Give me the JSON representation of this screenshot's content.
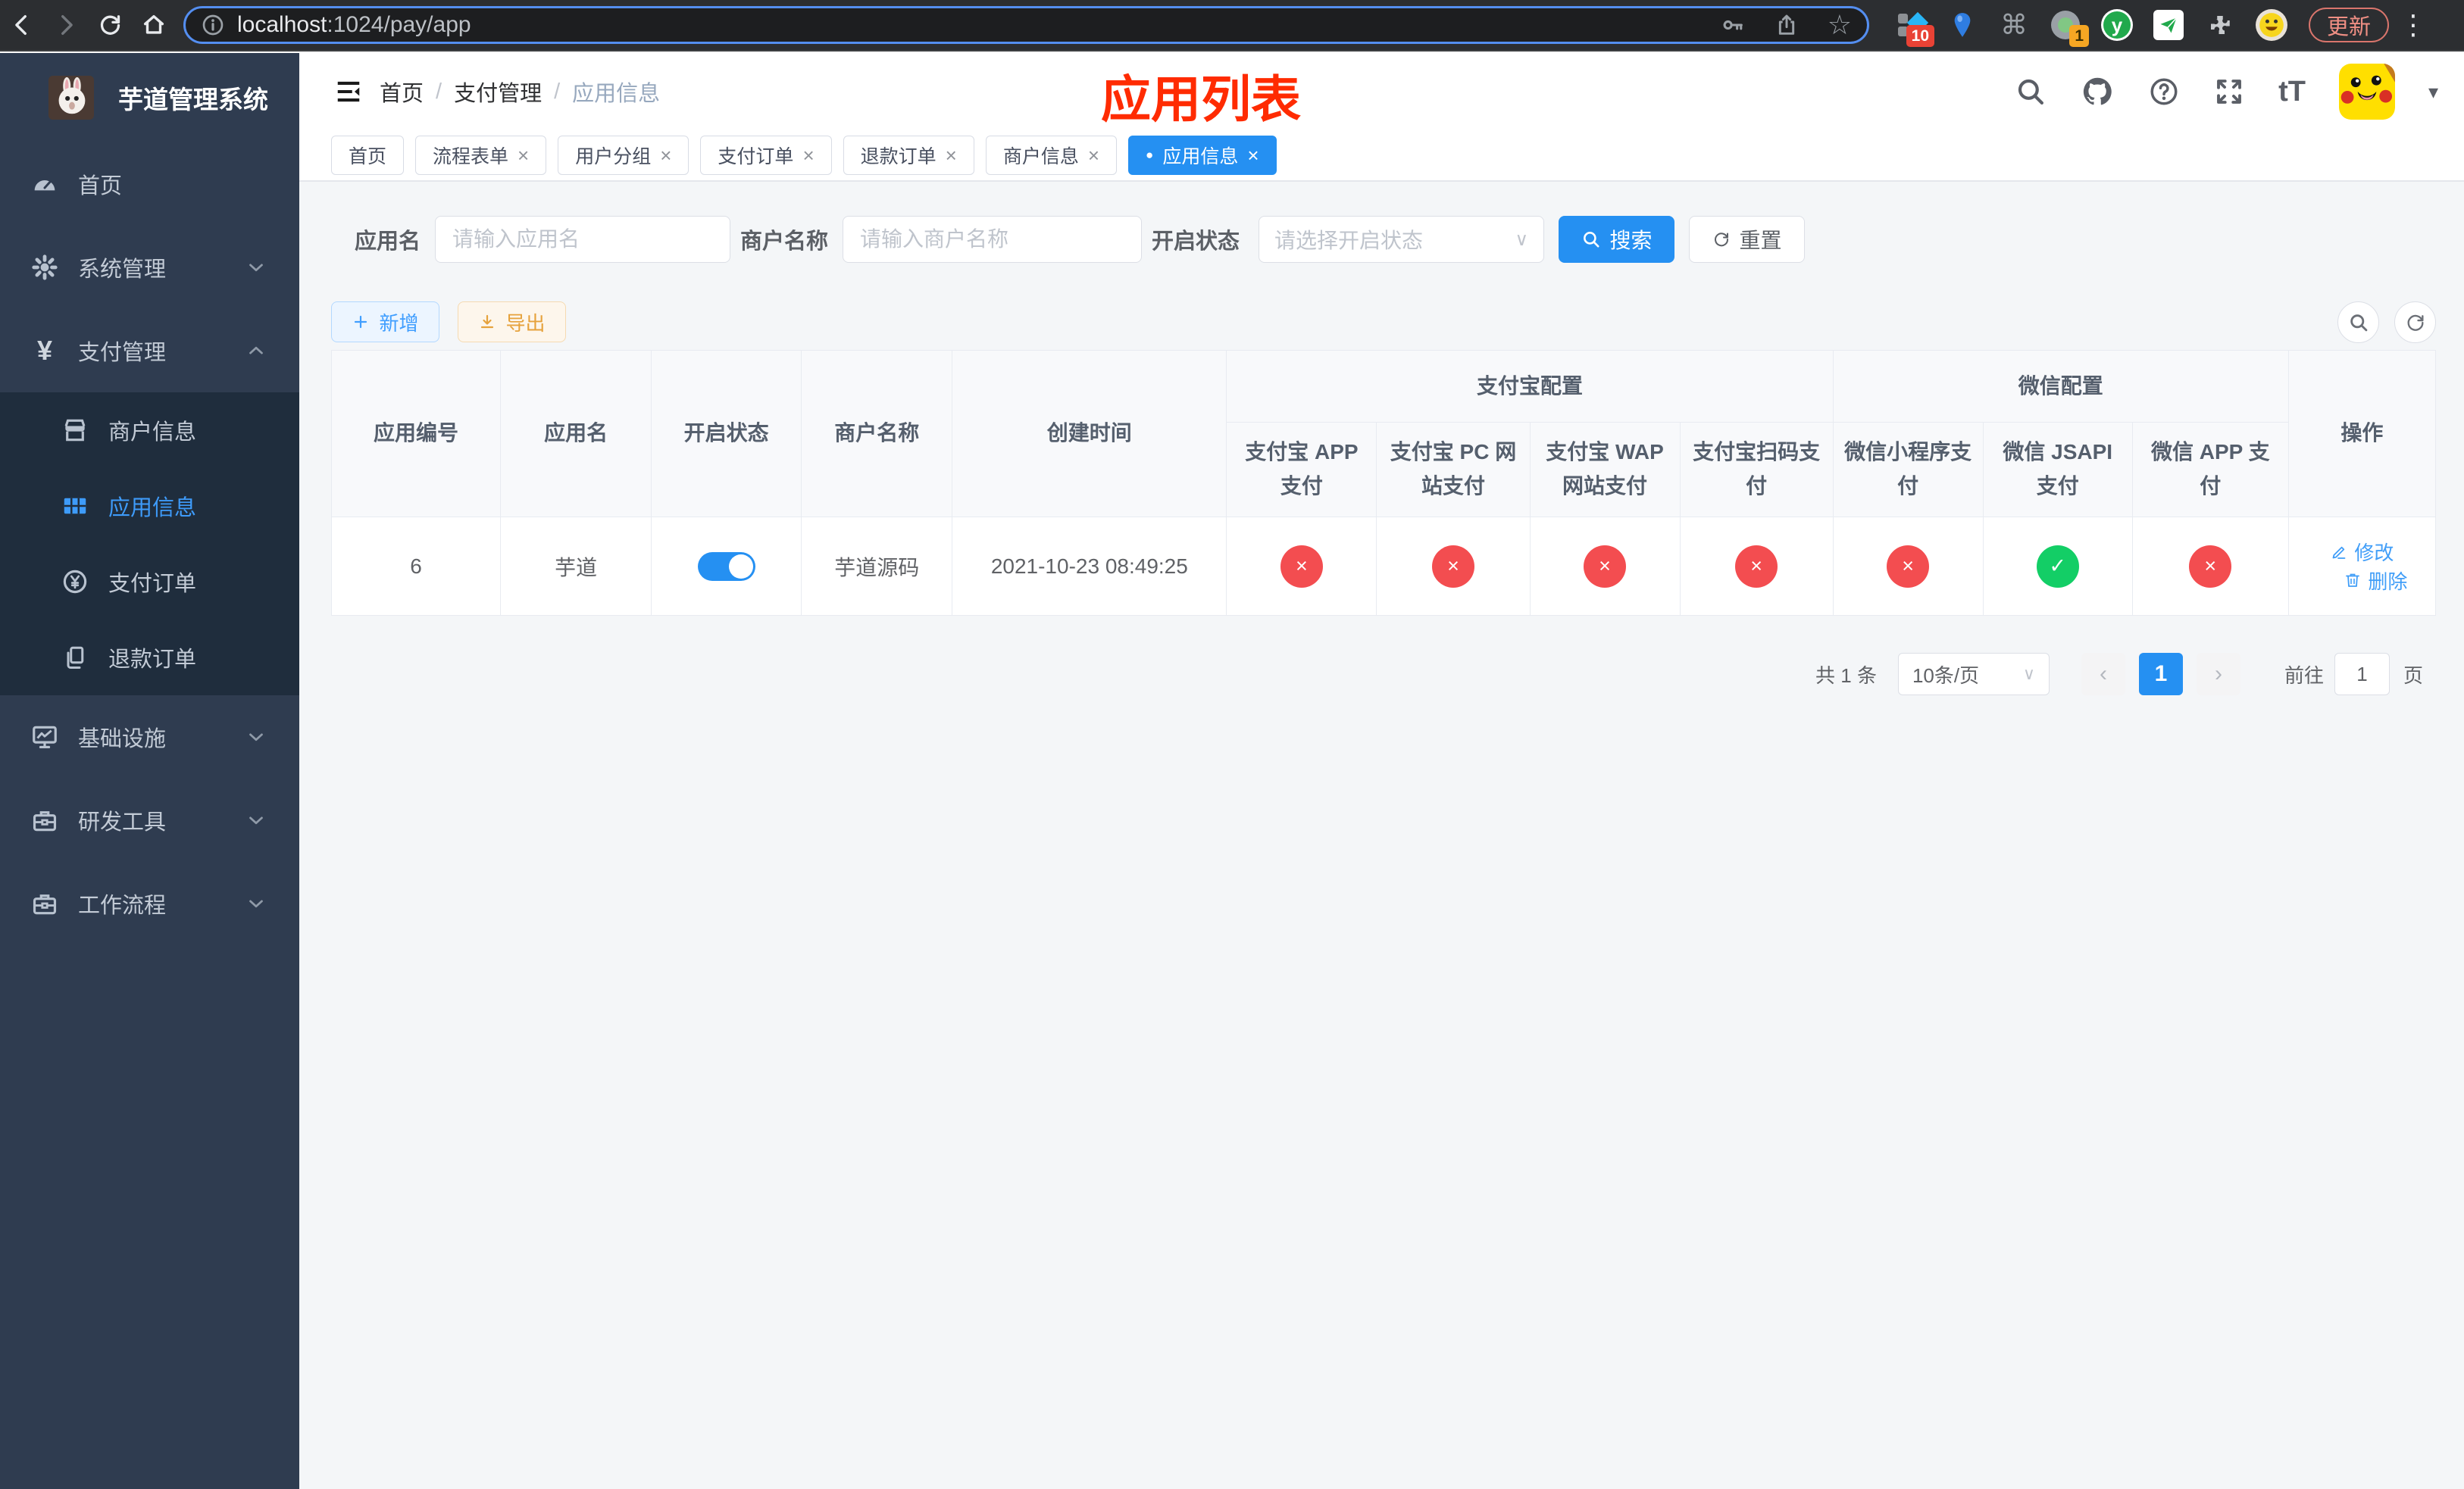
{
  "browser": {
    "url": {
      "host": "localhost",
      "path": ":1024/pay/app"
    },
    "update_button": "更新",
    "extension_badges": {
      "first": "10",
      "second": "1"
    }
  },
  "icons": {
    "close": "×",
    "check": "✓",
    "cross": "×",
    "prev": "‹",
    "next": "›",
    "dot": "●",
    "star": "☆",
    "command": "⌘",
    "dots_vertical": "⋮",
    "caret_down": "▾",
    "yen": "¥",
    "question": "?",
    "font_size": "tT",
    "y_letter": "y",
    "select_caret": "∨"
  },
  "sidebar": {
    "title": "芋道管理系统",
    "menu": [
      {
        "label": "首页"
      },
      {
        "label": "系统管理"
      },
      {
        "label": "支付管理"
      },
      {
        "label": "基础设施"
      },
      {
        "label": "研发工具"
      },
      {
        "label": "工作流程"
      }
    ],
    "submenu": [
      {
        "label": "商户信息"
      },
      {
        "label": "应用信息"
      },
      {
        "label": "支付订单"
      },
      {
        "label": "退款订单"
      }
    ]
  },
  "header": {
    "breadcrumb": [
      "首页",
      "支付管理",
      "应用信息"
    ],
    "separator": "/",
    "overlay_title": "应用列表"
  },
  "tabs": [
    {
      "label": "首页"
    },
    {
      "label": "流程表单"
    },
    {
      "label": "用户分组"
    },
    {
      "label": "支付订单"
    },
    {
      "label": "退款订单"
    },
    {
      "label": "商户信息"
    },
    {
      "label": "应用信息"
    }
  ],
  "filters": {
    "app_name_label": "应用名",
    "app_name_placeholder": "请输入应用名",
    "merchant_label": "商户名称",
    "merchant_placeholder": "请输入商户名称",
    "status_label": "开启状态",
    "status_placeholder": "请选择开启状态",
    "search_button": "搜索",
    "reset_button": "重置"
  },
  "toolbar": {
    "add_button": "新增",
    "export_button": "导出"
  },
  "table": {
    "columns": [
      "应用编号",
      "应用名",
      "开启状态",
      "商户名称",
      "创建时间"
    ],
    "groups": {
      "alipay": "支付宝配置",
      "wechat": "微信配置"
    },
    "pay_columns": [
      "支付宝 APP 支付",
      "支付宝 PC 网站支付",
      "支付宝 WAP 网站支付",
      "支付宝扫码支付",
      "微信小程序支付",
      "微信 JSAPI 支付",
      "微信 APP 支付"
    ],
    "actions_column": "操作",
    "row": {
      "id": "6",
      "name": "芋道",
      "enabled": true,
      "merchant": "芋道源码",
      "created_at": "2021-10-23 08:49:25",
      "statuses": [
        "no",
        "no",
        "no",
        "no",
        "no",
        "yes",
        "no"
      ],
      "edit": "修改",
      "delete": "删除"
    }
  },
  "pagination": {
    "total": "共 1 条",
    "page_size": "10条/页",
    "current_page": "1",
    "goto_label": "前往",
    "goto_value": "1",
    "unit_label": "页"
  },
  "colors": {
    "primary": "#2590f2",
    "success": "#13ce66",
    "danger": "#f34d50",
    "annotation_red": "#ff2b01",
    "sidebar_bg": "#2f3c50",
    "submenu_bg": "#1f2d3d"
  }
}
